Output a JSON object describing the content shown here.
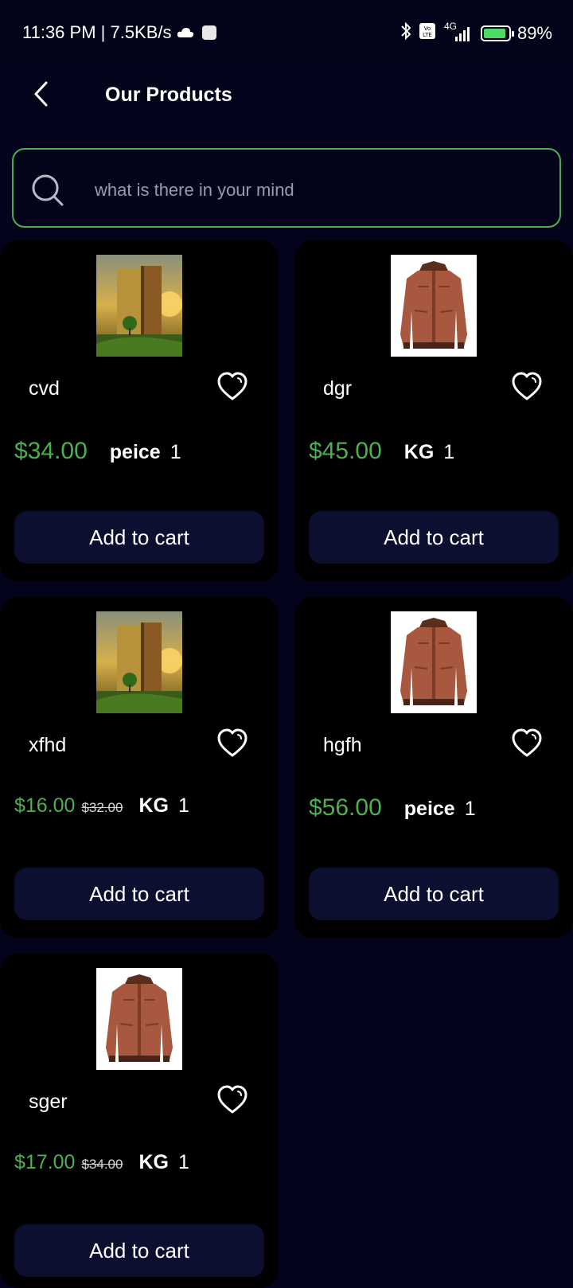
{
  "status_bar": {
    "time_speed": "11:36 PM | 7.5KB/s",
    "network": "4G",
    "battery": "89%",
    "battery_level": 0.89
  },
  "header": {
    "title": "Our Products",
    "back_icon": "chevron-left-icon"
  },
  "search": {
    "placeholder": "what is there in your mind",
    "value": ""
  },
  "colors": {
    "background": "#03041c",
    "card": "#000000",
    "accent_green": "#4caf50",
    "button": "#0c0f30"
  },
  "products": [
    {
      "name": "cvd",
      "price": "$34.00",
      "old_price": "",
      "unit": "peice",
      "qty": "1",
      "image": "book-landscape",
      "cart_label": "Add to cart"
    },
    {
      "name": "dgr",
      "price": "$45.00",
      "old_price": "",
      "unit": "KG",
      "qty": "1",
      "image": "leather-jacket",
      "cart_label": "Add to cart"
    },
    {
      "name": "xfhd",
      "price": "$16.00",
      "old_price": "$32.00",
      "unit": "KG",
      "qty": "1",
      "image": "book-landscape",
      "cart_label": "Add to cart"
    },
    {
      "name": "hgfh",
      "price": "$56.00",
      "old_price": "",
      "unit": "peice",
      "qty": "1",
      "image": "leather-jacket",
      "cart_label": "Add to cart"
    },
    {
      "name": "sger",
      "price": "$17.00",
      "old_price": "$34.00",
      "unit": "KG",
      "qty": "1",
      "image": "leather-jacket",
      "cart_label": "Add to cart"
    }
  ]
}
